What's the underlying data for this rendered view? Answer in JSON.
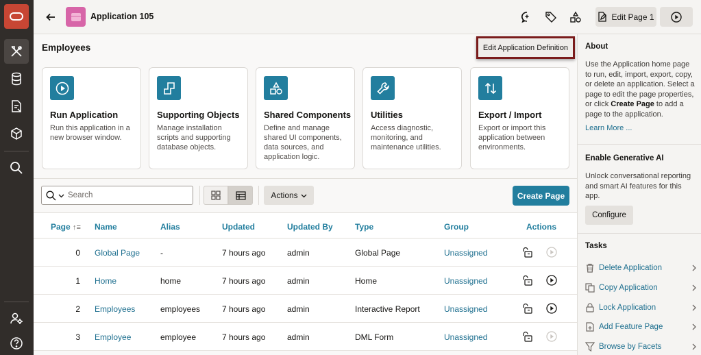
{
  "app": {
    "title": "Application 105",
    "edit_page_label": "Edit Page 1"
  },
  "nav": {
    "items": [
      "oracle-logo",
      "app-builder",
      "sql-workshop",
      "team-development",
      "gallery",
      "search",
      "administration",
      "help"
    ]
  },
  "main": {
    "page_title": "Employees",
    "edit_definition_label": "Edit Application Definition",
    "cards": [
      {
        "title": "Run Application",
        "desc": "Run this application in a new browser window.",
        "icon": "play-icon"
      },
      {
        "title": "Supporting Objects",
        "desc": "Manage installation scripts and supporting database objects.",
        "icon": "supporting-objects-icon"
      },
      {
        "title": "Shared Components",
        "desc": "Define and manage shared UI components, data sources, and application logic.",
        "icon": "shapes-icon"
      },
      {
        "title": "Utilities",
        "desc": "Access diagnostic, monitoring, and maintenance utilities.",
        "icon": "wrench-icon"
      },
      {
        "title": "Export / Import",
        "desc": "Export or import this application between environments.",
        "icon": "export-import-icon"
      }
    ],
    "search_placeholder": "Search",
    "actions_label": "Actions",
    "create_page_label": "Create Page",
    "columns": [
      "Page",
      "Name",
      "Alias",
      "Updated",
      "Updated By",
      "Type",
      "Group",
      "Actions"
    ],
    "rows": [
      {
        "page": "0",
        "name": "Global Page",
        "alias": "-",
        "updated": "7 hours ago",
        "updated_by": "admin",
        "type": "Global Page",
        "group": "Unassigned",
        "run_enabled": false
      },
      {
        "page": "1",
        "name": "Home",
        "alias": "home",
        "updated": "7 hours ago",
        "updated_by": "admin",
        "type": "Home",
        "group": "Unassigned",
        "run_enabled": true
      },
      {
        "page": "2",
        "name": "Employees",
        "alias": "employees",
        "updated": "7 hours ago",
        "updated_by": "admin",
        "type": "Interactive Report",
        "group": "Unassigned",
        "run_enabled": true
      },
      {
        "page": "3",
        "name": "Employee",
        "alias": "employee",
        "updated": "7 hours ago",
        "updated_by": "admin",
        "type": "DML Form",
        "group": "Unassigned",
        "run_enabled": false
      }
    ]
  },
  "panel": {
    "about_title": "About",
    "about_text_1": "Use the Application home page to run, edit, import, export, copy, or delete an application. Select a page to edit the page properties, or click ",
    "about_bold": "Create Page",
    "about_text_2": " to add a page to the application.",
    "learn_more": "Learn More ...",
    "genai_title": "Enable Generative AI",
    "genai_text": "Unlock conversational reporting and smart AI features for this app.",
    "configure_label": "Configure",
    "tasks_title": "Tasks",
    "tasks": [
      {
        "label": "Delete Application",
        "icon": "trash-icon"
      },
      {
        "label": "Copy Application",
        "icon": "copy-icon"
      },
      {
        "label": "Lock Application",
        "icon": "lock-icon"
      },
      {
        "label": "Add Feature Page",
        "icon": "add-page-icon"
      },
      {
        "label": "Browse by Facets",
        "icon": "filter-icon"
      }
    ]
  },
  "colors": {
    "accent": "#227e9e",
    "rail": "#312d2a",
    "logo": "#c74634",
    "app_icon": "#d765a8",
    "highlight_border": "#7a1b1b"
  }
}
